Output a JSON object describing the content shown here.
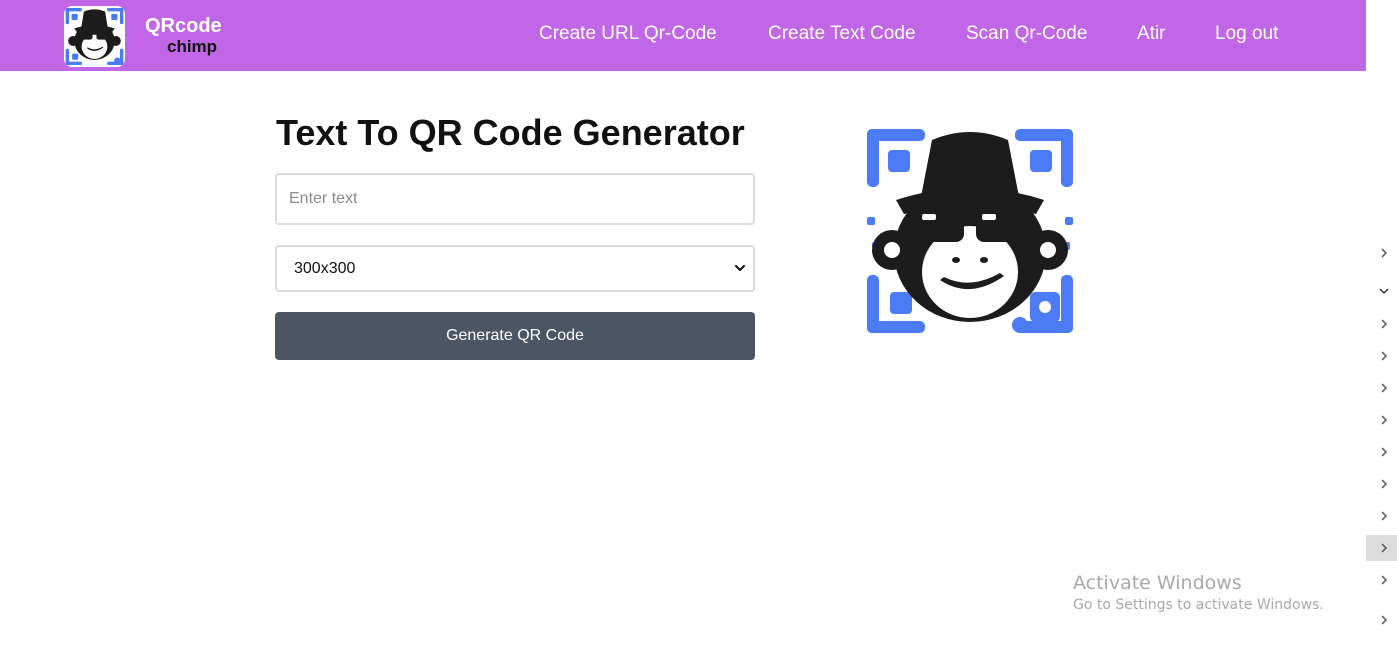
{
  "brand": {
    "line1": "QRcode",
    "line2": "chimp"
  },
  "nav": {
    "links": [
      {
        "label": "Create URL Qr-Code"
      },
      {
        "label": "Create Text Code"
      },
      {
        "label": "Scan Qr-Code"
      },
      {
        "label": "Atir"
      },
      {
        "label": "Log out"
      }
    ]
  },
  "main": {
    "title": "Text To QR Code Generator",
    "text_input": {
      "placeholder": "Enter text",
      "value": ""
    },
    "size_select": {
      "selected": "300x300"
    },
    "generate_label": "Generate QR Code"
  },
  "colors": {
    "navbar": "#c066e6",
    "button": "#4b5563",
    "qr_blue": "#4b7bf5",
    "chimp": "#1c1c1c"
  },
  "side_panel": {
    "icons": [
      "chevron-right-icon",
      "chevron-down-icon",
      "chevron-right-icon"
    ]
  },
  "watermark": {
    "title": "Activate Windows",
    "subtitle": "Go to Settings to activate Windows."
  }
}
